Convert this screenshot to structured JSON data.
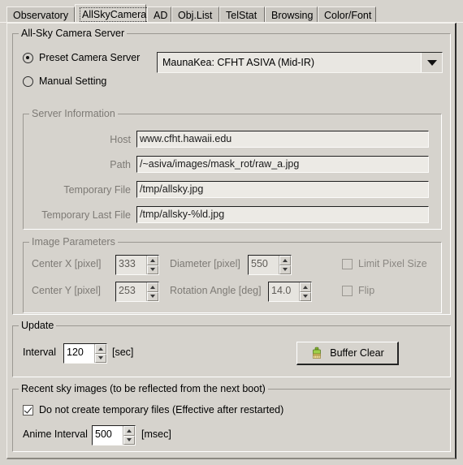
{
  "tabs": [
    {
      "label": "Observatory",
      "selected": false
    },
    {
      "label": "AllSkyCamera",
      "selected": true
    },
    {
      "label": "AD",
      "selected": false
    },
    {
      "label": "Obj.List",
      "selected": false
    },
    {
      "label": "TelStat",
      "selected": false
    },
    {
      "label": "Browsing",
      "selected": false
    },
    {
      "label": "Color/Font",
      "selected": false
    }
  ],
  "server_group": {
    "title": "All-Sky Camera Server",
    "preset_radio_label": "Preset Camera Server",
    "preset_radio_selected": true,
    "manual_radio_label": "Manual Setting",
    "manual_radio_selected": false,
    "combo_value": "MaunaKea: CFHT ASIVA (Mid-IR)",
    "combo_arrow_icon": "chevron-down-icon"
  },
  "server_info": {
    "title": "Server Information",
    "fields": [
      {
        "label": "Host",
        "value": "www.cfht.hawaii.edu"
      },
      {
        "label": "Path",
        "value": "/~asiva/images/mask_rot/raw_a.jpg"
      },
      {
        "label": "Temporary File",
        "value": "/tmp/allsky.jpg"
      },
      {
        "label": "Temporary Last File",
        "value": "/tmp/allsky-%ld.jpg"
      }
    ]
  },
  "image_params": {
    "title": "Image Parameters",
    "center_x_label": "Center X [pixel]",
    "center_x_value": "333",
    "center_y_label": "Center Y [pixel]",
    "center_y_value": "253",
    "diameter_label": "Diameter [pixel]",
    "diameter_value": "550",
    "rotation_label": "Rotation Angle [deg]",
    "rotation_value": "14.0",
    "limit_pixel_label": "Limit Pixel Size",
    "limit_pixel_checked": false,
    "flip_label": "Flip",
    "flip_checked": false
  },
  "update": {
    "title": "Update",
    "interval_label": "Interval",
    "interval_value": "120",
    "interval_unit": "[sec]",
    "buffer_clear_label": "Buffer Clear",
    "buffer_clear_icon": "brush-icon"
  },
  "recent": {
    "title": "Recent sky images (to be reflected from the next boot)",
    "no_temp_label": "Do not create temporary files (Effective after restarted)",
    "no_temp_checked": true,
    "anime_label": "Anime Interval",
    "anime_value": "500",
    "anime_unit": "[msec]"
  },
  "colors": {
    "face": "#d6d3cd",
    "field": "#eceae5",
    "disabled_text": "#7d7a75",
    "icon_green": "#8fbf3f"
  }
}
